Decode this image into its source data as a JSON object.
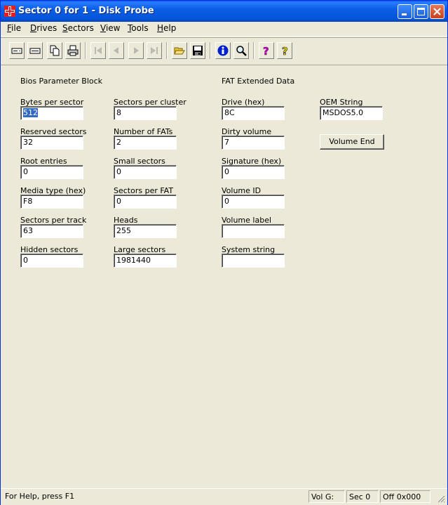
{
  "window": {
    "title": "Sector 0 for 1 - Disk Probe"
  },
  "menu": {
    "items": [
      {
        "underline": "F",
        "rest": "ile"
      },
      {
        "underline": "D",
        "rest": "rives"
      },
      {
        "underline": "S",
        "rest": "ectors"
      },
      {
        "underline": "V",
        "rest": "iew"
      },
      {
        "underline": "T",
        "rest": "ools"
      },
      {
        "underline": "H",
        "rest": "elp"
      }
    ]
  },
  "toolbar": {
    "icons": [
      "drive-icon",
      "partition-icon",
      "copy-icon",
      "print-icon",
      "first-sector-icon",
      "previous-sector-icon",
      "next-sector-icon",
      "last-sector-icon",
      "open-folder-icon",
      "save-icon",
      "info-icon",
      "search-icon",
      "help-icon",
      "context-help-icon"
    ]
  },
  "bpb": {
    "title": "Bios Parameter Block",
    "fields": {
      "bytes_per_sector": {
        "label": "Bytes per sector",
        "value": "512"
      },
      "sectors_per_cluster": {
        "label": "Sectors per cluster",
        "value": "8"
      },
      "reserved_sectors": {
        "label": "Reserved sectors",
        "value": "32"
      },
      "number_of_fats": {
        "label": "Number of FATs",
        "value": "2"
      },
      "root_entries": {
        "label": "Root entries",
        "value": "0"
      },
      "small_sectors": {
        "label": "Small sectors",
        "value": "0"
      },
      "media_type": {
        "label": "Media type (hex)",
        "value": "F8"
      },
      "sectors_per_fat": {
        "label": "Sectors per FAT",
        "value": "0"
      },
      "sectors_per_track": {
        "label": "Sectors per track",
        "value": "63"
      },
      "heads": {
        "label": "Heads",
        "value": "255"
      },
      "hidden_sectors": {
        "label": "Hidden sectors",
        "value": "0"
      },
      "large_sectors": {
        "label": "Large sectors",
        "value": "1981440"
      }
    }
  },
  "fat_ext": {
    "title": "FAT Extended Data",
    "fields": {
      "drive": {
        "label": "Drive (hex)",
        "value": "8C"
      },
      "dirty_volume": {
        "label": "Dirty volume",
        "value": "7"
      },
      "signature": {
        "label": "Signature (hex)",
        "value": "0"
      },
      "volume_id": {
        "label": "Volume ID",
        "value": "0"
      },
      "volume_label": {
        "label": "Volume label",
        "value": ""
      },
      "system_string": {
        "label": "System string",
        "value": ""
      }
    }
  },
  "oem": {
    "label": "OEM String",
    "value": "MSDOS5.0",
    "button_label": "Volume End"
  },
  "status": {
    "help": "For Help, press F1",
    "vol": "Vol  G:",
    "sec": "Sec 0",
    "off": "Off 0x000"
  },
  "colors": {
    "titlebar": "#0A5FE6",
    "face": "#ECE9D8",
    "selection": "#316AC5"
  }
}
